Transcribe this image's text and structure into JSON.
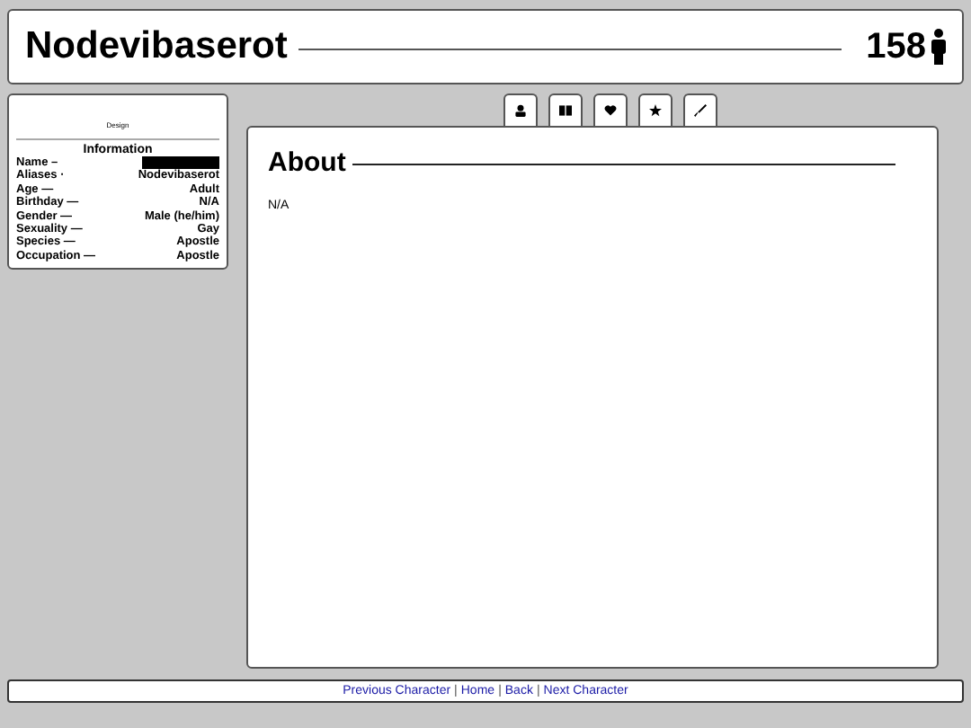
{
  "header": {
    "title": "Nodevibaserot",
    "count": "158"
  },
  "sidebar": {
    "caption": "Design",
    "heading": "Information",
    "rows": [
      {
        "label": "Name –",
        "kind": "redacted"
      },
      {
        "label": "Aliases ·",
        "kind": "text",
        "value": "Nodevibaserot"
      },
      {
        "label": "Age —",
        "kind": "text",
        "value": "Adult"
      },
      {
        "label": "Birthday —",
        "kind": "text",
        "value": "N/A"
      },
      {
        "label": "Gender —",
        "kind": "text",
        "value": "Male (he/him)"
      },
      {
        "label": "Sexuality —",
        "kind": "text",
        "value": "Gay"
      },
      {
        "label": "Species —",
        "kind": "text",
        "value": "Apostle"
      },
      {
        "label": "Occupation —",
        "kind": "text",
        "value": "Apostle"
      }
    ]
  },
  "tabs": [
    {
      "kind": "person"
    },
    {
      "kind": "book"
    },
    {
      "kind": "heart"
    },
    {
      "kind": "star"
    },
    {
      "kind": "brush"
    }
  ],
  "content": {
    "heading": "About",
    "text": "N/A"
  },
  "footer": {
    "separator": "|",
    "links": [
      "Previous Character",
      "Home",
      "Back",
      "Next Character"
    ]
  }
}
